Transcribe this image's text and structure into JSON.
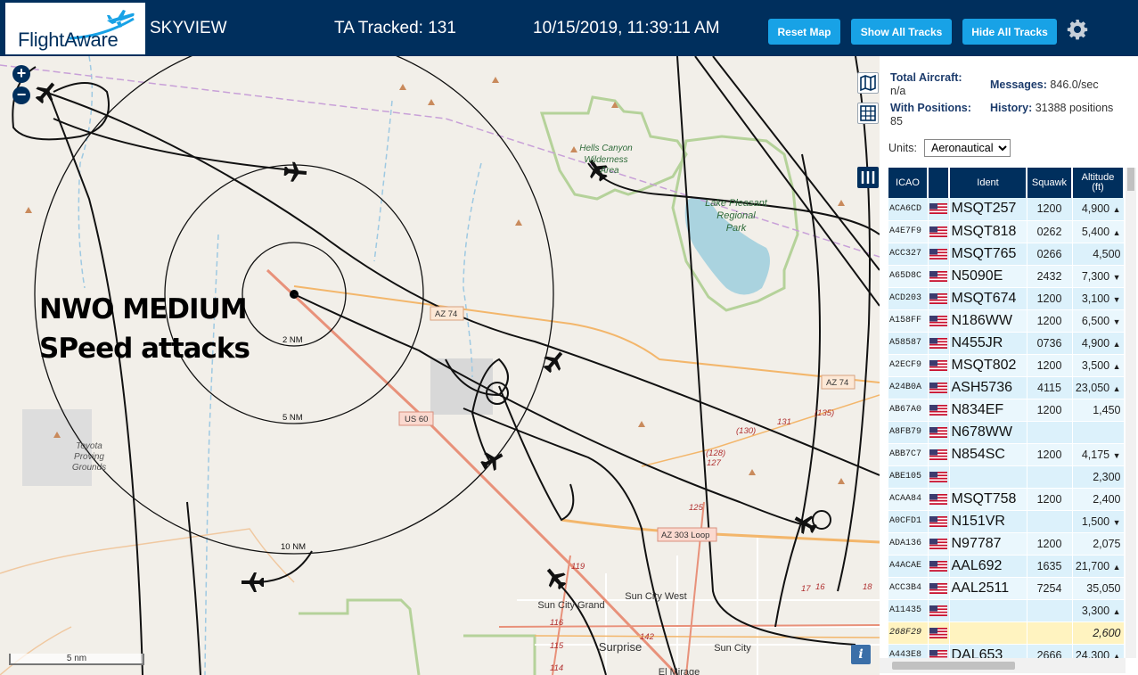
{
  "header": {
    "logo_text": "FlightAware",
    "title": "SKYVIEW",
    "tracked_label": "TA Tracked: 131",
    "clock": "10/15/2019, 11:39:11 AM",
    "buttons": {
      "reset": "Reset Map",
      "show_all": "Show All Tracks",
      "hide_all": "Hide All Tracks"
    },
    "colors": {
      "bar": "#002f5d",
      "button": "#18a2e6"
    }
  },
  "map": {
    "overlay_line1": "NWO MEDIUM",
    "overlay_line2": "SPeed attacks",
    "zoom_in": "+",
    "zoom_out": "−",
    "scale": "5 nm",
    "info": "i",
    "range_rings": [
      "2 NM",
      "5 NM",
      "10 NM"
    ],
    "places": {
      "hells_canyon_1": "Hells Canyon",
      "hells_canyon_2": "Wilderness",
      "hells_canyon_3": "Area",
      "lake_1": "Lake Pleasant",
      "lake_2": "Regional",
      "lake_3": "Park",
      "proving_1": "Toyota",
      "proving_2": "Proving",
      "proving_3": "Grounds",
      "sun_city_west": "Sun City West",
      "sun_city_grand": "Sun City Grand",
      "surprise": "Surprise",
      "sun_city": "Sun City",
      "el_mirage": "El Mirage"
    },
    "roads": {
      "az74_a": "AZ 74",
      "az74_b": "AZ 74",
      "us60": "US 60",
      "az303": "AZ 303 Loop",
      "r131": "131",
      "r135": "(135)",
      "r130": "(130)",
      "r128": "(128)",
      "r127": "127",
      "r125": "125",
      "r119": "119",
      "r116": "116",
      "r115": "115",
      "r114": "114",
      "r142": "142",
      "r17": "17",
      "r16": "16",
      "r18": "18"
    }
  },
  "stats": {
    "total_label": "Total Aircraft:",
    "total_value": "n/a",
    "positions_label": "With Positions:",
    "positions_value": "85",
    "messages_label": "Messages:",
    "messages_value": "846.0/sec",
    "history_label": "History:",
    "history_value": "31388 positions"
  },
  "units": {
    "label": "Units:",
    "selected": "Aeronautical"
  },
  "table": {
    "headers": [
      "ICAO",
      "",
      "Ident",
      "Squawk",
      "Altitude (ft)"
    ],
    "rows": [
      {
        "icao": "ACA6CD",
        "ident": "MSQT257",
        "squawk": "1200",
        "altitude": "4,900",
        "trend": "▲"
      },
      {
        "icao": "A4E7F9",
        "ident": "MSQT818",
        "squawk": "0262",
        "altitude": "5,400",
        "trend": "▲"
      },
      {
        "icao": "ACC327",
        "ident": "MSQT765",
        "squawk": "0266",
        "altitude": "4,500",
        "trend": ""
      },
      {
        "icao": "A65D8C",
        "ident": "N5090E",
        "squawk": "2432",
        "altitude": "7,300",
        "trend": "▼"
      },
      {
        "icao": "ACD203",
        "ident": "MSQT674",
        "squawk": "1200",
        "altitude": "3,100",
        "trend": "▼"
      },
      {
        "icao": "A158FF",
        "ident": "N186WW",
        "squawk": "1200",
        "altitude": "6,500",
        "trend": "▼"
      },
      {
        "icao": "A58587",
        "ident": "N455JR",
        "squawk": "0736",
        "altitude": "4,900",
        "trend": "▲"
      },
      {
        "icao": "A2ECF9",
        "ident": "MSQT802",
        "squawk": "1200",
        "altitude": "3,500",
        "trend": "▲"
      },
      {
        "icao": "A24B0A",
        "ident": "ASH5736",
        "squawk": "4115",
        "altitude": "23,050",
        "trend": "▲"
      },
      {
        "icao": "AB67A0",
        "ident": "N834EF",
        "squawk": "1200",
        "altitude": "1,450",
        "trend": ""
      },
      {
        "icao": "A8FB79",
        "ident": "N678WW",
        "squawk": "",
        "altitude": "",
        "trend": ""
      },
      {
        "icao": "ABB7C7",
        "ident": "N854SC",
        "squawk": "1200",
        "altitude": "4,175",
        "trend": "▼"
      },
      {
        "icao": "ABE105",
        "ident": "",
        "squawk": "",
        "altitude": "2,300",
        "trend": ""
      },
      {
        "icao": "ACAA84",
        "ident": "MSQT758",
        "squawk": "1200",
        "altitude": "2,400",
        "trend": ""
      },
      {
        "icao": "A0CFD1",
        "ident": "N151VR",
        "squawk": "",
        "altitude": "1,500",
        "trend": "▼"
      },
      {
        "icao": "ADA136",
        "ident": "N97787",
        "squawk": "1200",
        "altitude": "2,075",
        "trend": ""
      },
      {
        "icao": "A4ACAE",
        "ident": "AAL692",
        "squawk": "1635",
        "altitude": "21,700",
        "trend": "▲"
      },
      {
        "icao": "ACC3B4",
        "ident": "AAL2511",
        "squawk": "7254",
        "altitude": "35,050",
        "trend": ""
      },
      {
        "icao": "A11435",
        "ident": "",
        "squawk": "",
        "altitude": "3,300",
        "trend": "▲"
      },
      {
        "icao": "268F29",
        "ident": "",
        "squawk": "",
        "altitude": "2,600",
        "trend": "",
        "selected": true
      },
      {
        "icao": "A443E8",
        "ident": "DAL653",
        "squawk": "2666",
        "altitude": "24,300",
        "trend": "▲"
      }
    ]
  }
}
